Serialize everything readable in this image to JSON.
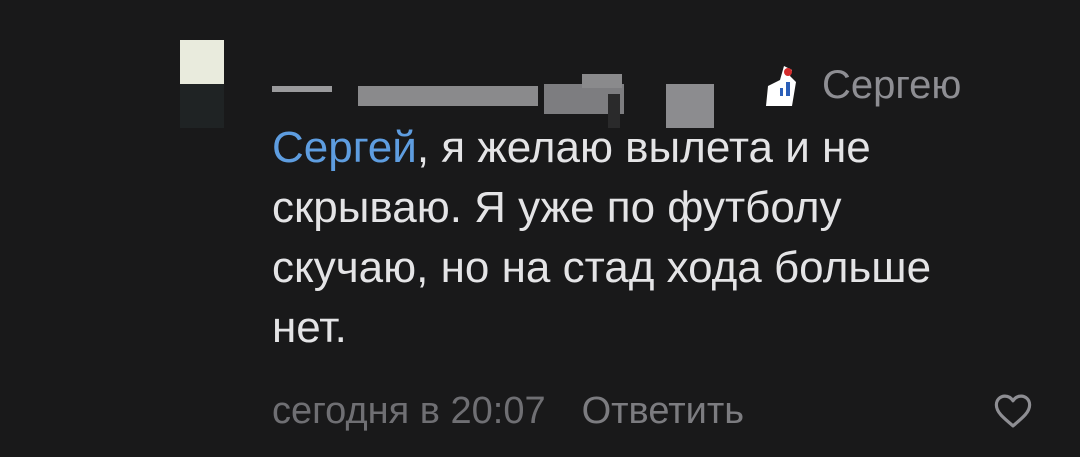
{
  "comment": {
    "reply_to_name": "Сергею",
    "mention": "Сергей",
    "text_after_mention": ", я желаю вылета и не скрываю. Я уже по футболу скучаю, но на стад хода больше нет.",
    "timestamp": "сегодня в 20:07",
    "reply_label": "Ответить"
  },
  "icons": {
    "like": "heart-outline-icon",
    "team": "team-emblem-icon"
  },
  "colors": {
    "background": "#19191a",
    "text": "#e4e4e6",
    "mention": "#5e9de0",
    "secondary": "#8e8e93"
  }
}
